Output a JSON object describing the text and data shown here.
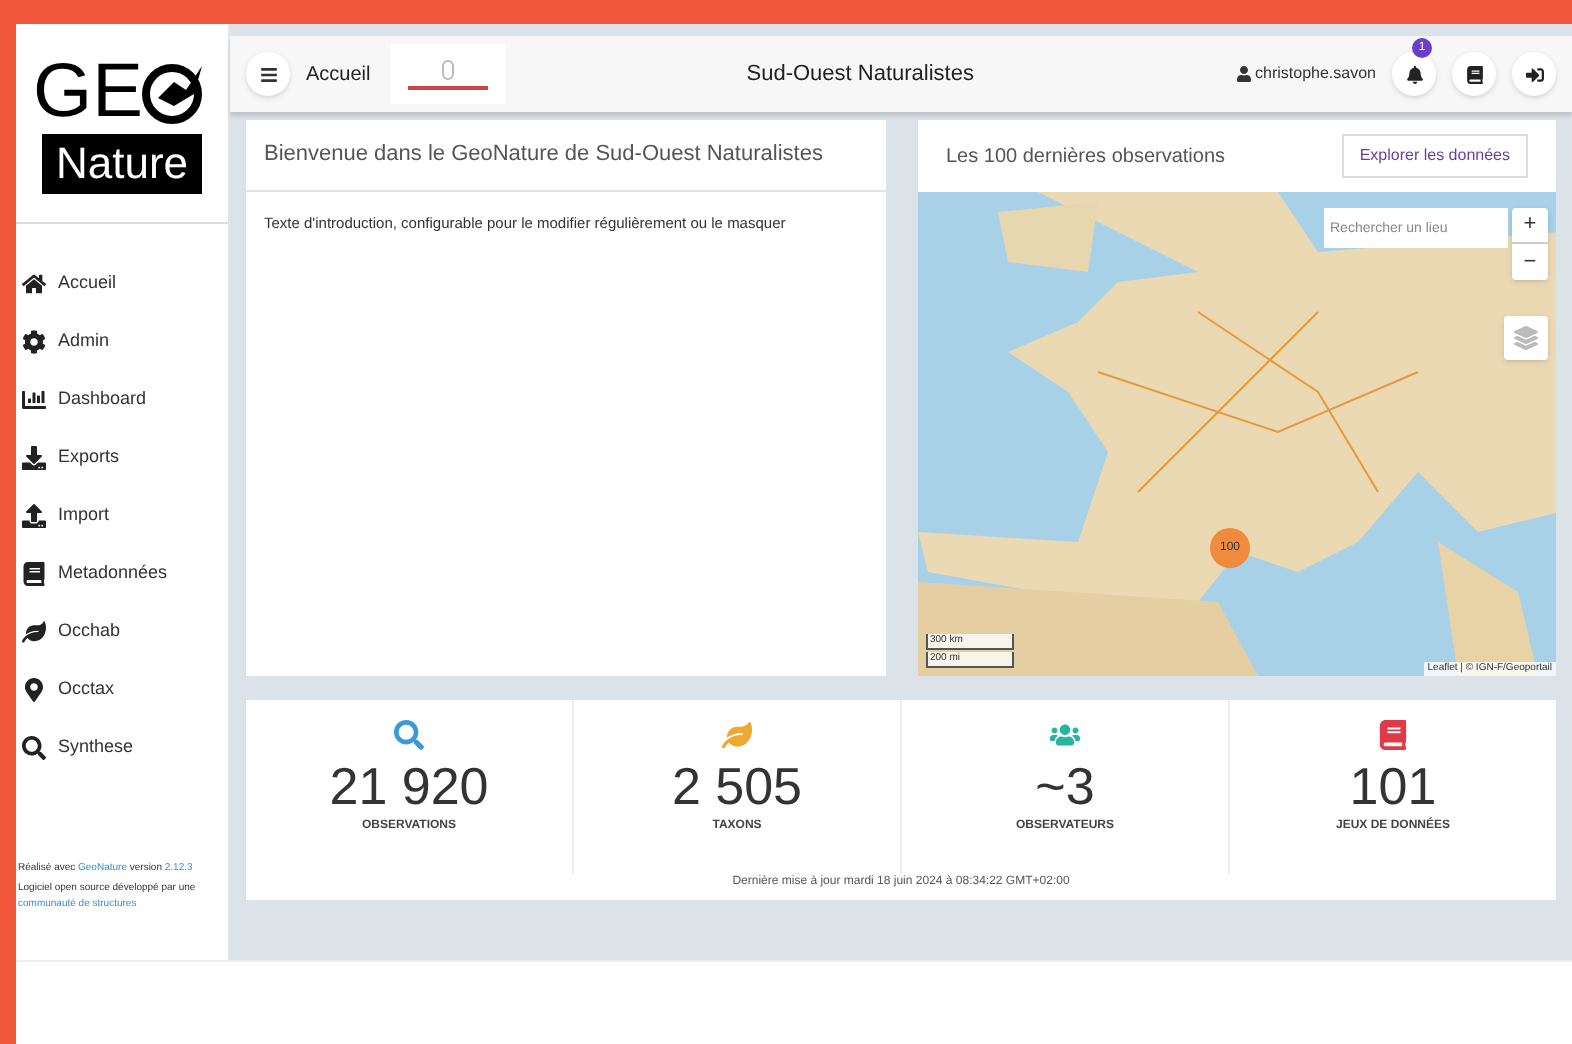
{
  "logo": {
    "top": "GE",
    "bottom": "Nature"
  },
  "header": {
    "menu": "Accueil",
    "title": "Sud-Ouest Naturalistes",
    "user": "christophe.savon",
    "notifications": "1"
  },
  "sidebar": {
    "items": [
      {
        "label": "Accueil",
        "kind": "home"
      },
      {
        "label": "Admin",
        "kind": "admin"
      },
      {
        "label": "Dashboard",
        "kind": "dashboard"
      },
      {
        "label": "Exports",
        "kind": "exports"
      },
      {
        "label": "Import",
        "kind": "import"
      },
      {
        "label": "Metadonnées",
        "kind": "metadata"
      },
      {
        "label": "Occhab",
        "kind": "occhab"
      },
      {
        "label": "Occtax",
        "kind": "occtax"
      },
      {
        "label": "Synthese",
        "kind": "synthese"
      }
    ],
    "footer": [
      [
        {
          "text": "Réalisé avec ",
          "link": false
        },
        {
          "text": "GeoNature",
          "link": true
        },
        {
          "text": " version ",
          "link": false
        },
        {
          "text": "2.12.3",
          "link": true
        }
      ],
      [
        {
          "text": "Logiciel open source développé par une ",
          "link": false
        },
        {
          "text": "communauté de structures",
          "link": true
        }
      ]
    ]
  },
  "welcome": {
    "title": "Bienvenue dans le GeoNature de Sud-Ouest Naturalistes",
    "text": "Texte d'introduction, configurable pour le modifier régulièrement ou le masquer"
  },
  "map": {
    "title": "Les 100 dernières observations",
    "button": "Explorer les données",
    "search_placeholder": "Rechercher un lieu",
    "zoom_in": "+",
    "zoom_out": "−",
    "cluster": "100",
    "scale": [
      "300 km",
      "200 mi"
    ],
    "attribution": "Leaflet | © IGN-F/Geoportail"
  },
  "stats": [
    {
      "value": "21 920",
      "label": "OBSERVATIONS",
      "kind": "search",
      "color": "#3a9ad9"
    },
    {
      "value": "2 505",
      "label": "TAXONS",
      "kind": "leaf",
      "color": "#f0a830"
    },
    {
      "value": "~3",
      "label": "OBSERVATEURS",
      "kind": "users",
      "color": "#26b5a0"
    },
    {
      "value": "101",
      "label": "JEUX DE DONNÉES",
      "kind": "book",
      "color": "#e0394a"
    }
  ],
  "last_update": "Dernière mise à jour mardi 18 juin 2024 à 08:34:22 GMT+02:00"
}
